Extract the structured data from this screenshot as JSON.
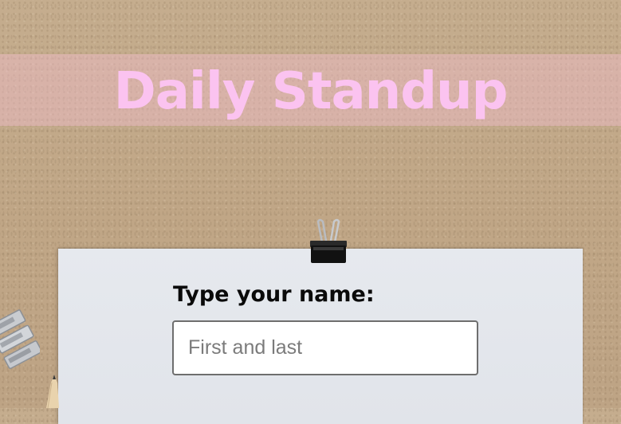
{
  "header": {
    "title": "Daily Standup"
  },
  "form": {
    "name_label": "Type your name:",
    "name_input": {
      "value": "",
      "placeholder": "First and last"
    }
  },
  "colors": {
    "title_text": "#fbc3f0",
    "title_band": "#f5bed2",
    "background_cardboard": "#c2a98a",
    "paper": "#e3e6eb"
  },
  "icons": {
    "binder_clip": "binder-clip-icon",
    "side_clips": "metal-clips-icon",
    "pencil": "pencil-icon"
  }
}
